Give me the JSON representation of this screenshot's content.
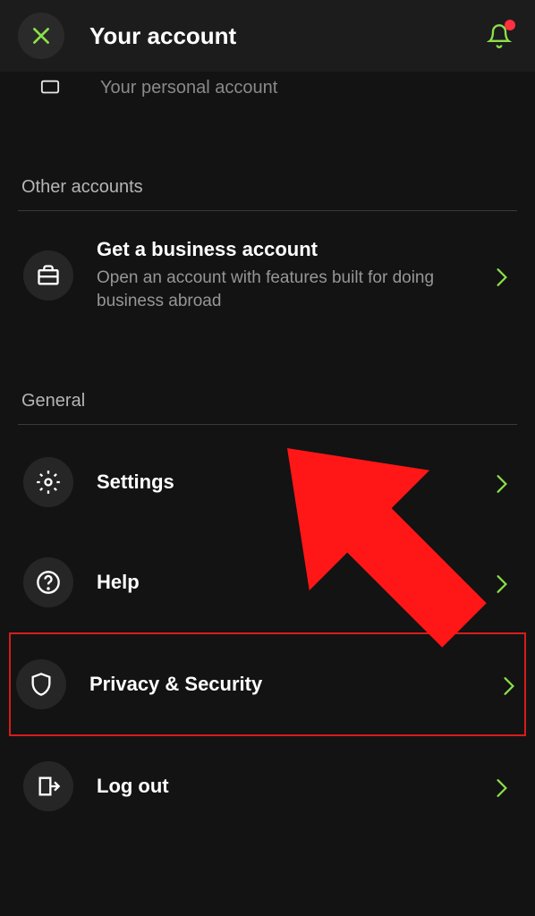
{
  "header": {
    "title": "Your account"
  },
  "partial": {
    "text": "Your personal account"
  },
  "sections": {
    "other_accounts": {
      "label": "Other accounts",
      "business": {
        "title": "Get a business account",
        "subtitle": "Open an account with features built for doing business abroad"
      }
    },
    "general": {
      "label": "General",
      "settings": "Settings",
      "help": "Help",
      "privacy": "Privacy & Security",
      "logout": "Log out"
    }
  }
}
